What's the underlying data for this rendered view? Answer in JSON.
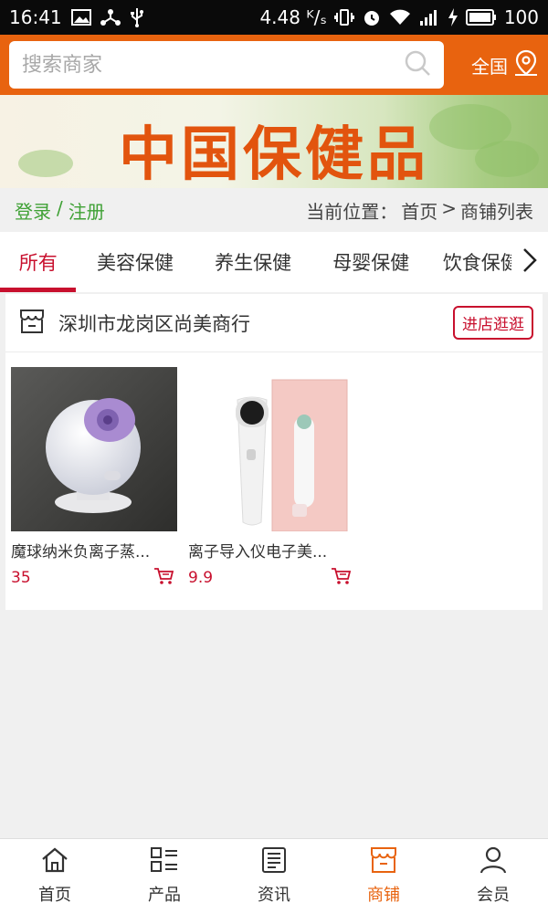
{
  "status_bar": {
    "time": "16:41",
    "speed": "4.48 ᴷ/ₛ",
    "battery": "100"
  },
  "search": {
    "placeholder": "搜索商家"
  },
  "region": {
    "label": "全国"
  },
  "banner": {
    "title": "中国保健品"
  },
  "auth": {
    "login": "登录",
    "separator": "/",
    "register": "注册"
  },
  "breadcrumb": {
    "prefix": "当前位置：",
    "home": "首页",
    "arrow": ">",
    "current": "商铺列表"
  },
  "tabs": [
    {
      "label": "所有"
    },
    {
      "label": "美容保健"
    },
    {
      "label": "养生保健"
    },
    {
      "label": "母婴保健"
    },
    {
      "label": "饮食保健"
    }
  ],
  "shop": {
    "name": "深圳市龙岗区尚美商行",
    "enter_label": "进店逛逛"
  },
  "products": [
    {
      "name": "魔球纳米负离子蒸...",
      "price": "35"
    },
    {
      "name": "离子导入仪电子美...",
      "price": "9.9"
    }
  ],
  "bottom_nav": [
    {
      "label": "首页",
      "icon": "home-icon"
    },
    {
      "label": "产品",
      "icon": "list-icon"
    },
    {
      "label": "资讯",
      "icon": "news-icon"
    },
    {
      "label": "商铺",
      "icon": "shop-icon"
    },
    {
      "label": "会员",
      "icon": "user-icon"
    }
  ],
  "colors": {
    "brand_orange": "#e8630f",
    "accent_red": "#c8102e",
    "login_green": "#3fa135"
  }
}
